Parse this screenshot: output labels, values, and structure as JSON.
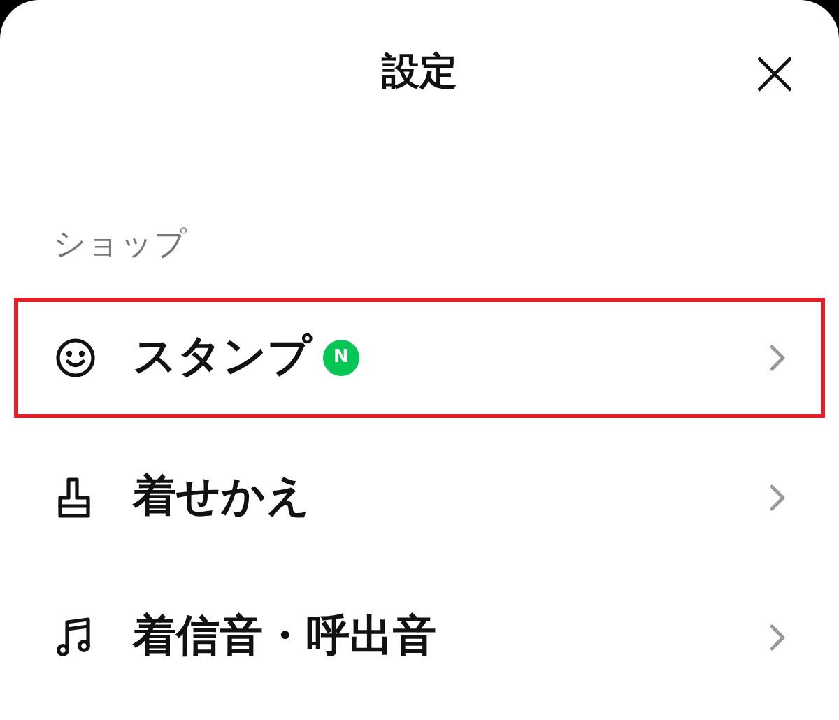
{
  "header": {
    "title": "設定",
    "close": "×"
  },
  "section": {
    "title": "ショップ"
  },
  "items": [
    {
      "kind": "smile",
      "label": "スタンプ",
      "badge": "N",
      "highlighted": true
    },
    {
      "kind": "brush",
      "label": "着せかえ",
      "highlighted": false
    },
    {
      "kind": "music",
      "label": "着信音・呼出音",
      "highlighted": false
    }
  ]
}
